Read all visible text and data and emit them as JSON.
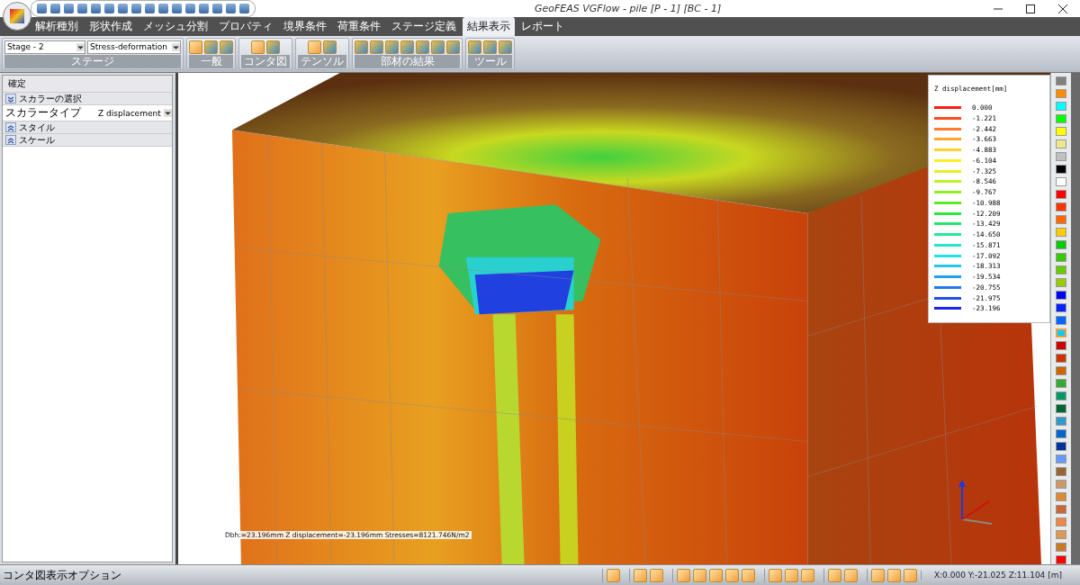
{
  "window": {
    "title": "GeoFEAS VGFlow - pile [P - 1] [BC - 1]"
  },
  "tabs": [
    {
      "label": "解析種別",
      "selected": false
    },
    {
      "label": "形状作成",
      "selected": false
    },
    {
      "label": "メッシュ分割",
      "selected": false
    },
    {
      "label": "プロパティ",
      "selected": false
    },
    {
      "label": "境界条件",
      "selected": false
    },
    {
      "label": "荷重条件",
      "selected": false
    },
    {
      "label": "ステージ定義",
      "selected": false
    },
    {
      "label": "結果表示",
      "selected": true
    },
    {
      "label": "レポート",
      "selected": false
    }
  ],
  "ribbon": {
    "stage_value": "Stage - 2",
    "analysis_value": "Stress-deformation",
    "groups": [
      {
        "label": "ステージ",
        "kind": "selects"
      },
      {
        "label": "一般",
        "kind": "icons"
      },
      {
        "label": "コンタ図",
        "kind": "icons"
      },
      {
        "label": "テンソル",
        "kind": "icons"
      },
      {
        "label": "部材の結果",
        "kind": "icons"
      },
      {
        "label": "ツール",
        "kind": "icons"
      }
    ]
  },
  "panel": {
    "header": "確定",
    "rows": [
      {
        "kind": "section",
        "label": "スカラーの選択",
        "expanded": true
      },
      {
        "kind": "property",
        "label": "スカラータイプ",
        "value": "Z displacement"
      },
      {
        "kind": "section",
        "label": "スタイル",
        "expanded": false
      },
      {
        "kind": "section",
        "label": "スケール",
        "expanded": false
      }
    ]
  },
  "legend": {
    "title": "Z displacement[mm]",
    "entries": [
      {
        "value": "0.000",
        "color": "#ff1a1a"
      },
      {
        "value": "-1.221",
        "color": "#ff4a1a"
      },
      {
        "value": "-2.442",
        "color": "#ff7a2a"
      },
      {
        "value": "-3.663",
        "color": "#ffa52a"
      },
      {
        "value": "-4.883",
        "color": "#ffd02a"
      },
      {
        "value": "-6.104",
        "color": "#ffee22"
      },
      {
        "value": "-7.325",
        "color": "#e6f022"
      },
      {
        "value": "-8.546",
        "color": "#bff022"
      },
      {
        "value": "-9.767",
        "color": "#8cf022"
      },
      {
        "value": "-10.988",
        "color": "#5aee22"
      },
      {
        "value": "-12.209",
        "color": "#2ee63a"
      },
      {
        "value": "-13.429",
        "color": "#22e66a"
      },
      {
        "value": "-14.650",
        "color": "#22e69a"
      },
      {
        "value": "-15.871",
        "color": "#22e6c6"
      },
      {
        "value": "-17.092",
        "color": "#22e0e6"
      },
      {
        "value": "-18.313",
        "color": "#22c6ee"
      },
      {
        "value": "-19.534",
        "color": "#22a0ee"
      },
      {
        "value": "-20.755",
        "color": "#2278ee"
      },
      {
        "value": "-21.975",
        "color": "#2250ee"
      },
      {
        "value": "-23.196",
        "color": "#1a22ee"
      }
    ]
  },
  "probe": "Dbh:=23.196mm  Z displacement=-23.196mm  Stresses=8121.746N/m2",
  "palette": [
    {
      "color": "#808080",
      "selected": false
    },
    {
      "color": "#ff8c00",
      "selected": false
    },
    {
      "color": "#00ffff",
      "selected": false
    },
    {
      "color": "#00ff00",
      "selected": false
    },
    {
      "color": "#ffff00",
      "selected": false
    },
    {
      "color": "#f0e68c",
      "selected": false
    },
    {
      "color": "#c0c0c0",
      "selected": false
    },
    {
      "color": "#000000",
      "selected": false
    },
    {
      "color": "#ffffff",
      "selected": false
    },
    {
      "color": "#ff0000",
      "selected": false
    },
    {
      "color": "#ff3300",
      "selected": false
    },
    {
      "color": "#ff6600",
      "selected": false
    },
    {
      "color": "#ffcc00",
      "selected": false
    },
    {
      "color": "#00cc00",
      "selected": false
    },
    {
      "color": "#33cc00",
      "selected": false
    },
    {
      "color": "#66cc00",
      "selected": false
    },
    {
      "color": "#99cc00",
      "selected": false
    },
    {
      "color": "#0000ff",
      "selected": false
    },
    {
      "color": "#0022ff",
      "selected": false
    },
    {
      "color": "#0066ff",
      "selected": false
    },
    {
      "color": "#00ccff",
      "selected": true
    },
    {
      "color": "#cc0000",
      "selected": false
    },
    {
      "color": "#cc3300",
      "selected": false
    },
    {
      "color": "#cc6600",
      "selected": false
    },
    {
      "color": "#33aa33",
      "selected": false
    },
    {
      "color": "#009966",
      "selected": false
    },
    {
      "color": "#006633",
      "selected": false
    },
    {
      "color": "#3399cc",
      "selected": false
    },
    {
      "color": "#0066cc",
      "selected": false
    },
    {
      "color": "#003399",
      "selected": false
    },
    {
      "color": "#6699ff",
      "selected": false
    },
    {
      "color": "#996633",
      "selected": false
    },
    {
      "color": "#cc9966",
      "selected": false
    },
    {
      "color": "#dd8833",
      "selected": false
    },
    {
      "color": "#cc6633",
      "selected": false
    },
    {
      "color": "#ee8844",
      "selected": false
    },
    {
      "color": "#dd9955",
      "selected": false
    },
    {
      "color": "#cc7722",
      "selected": false
    },
    {
      "color": "#ff0000",
      "selected": false
    }
  ],
  "status": {
    "label": "コンタ図表示オプション",
    "coords": "X:0.000 Y:-21.025 Z:11.104 [m]"
  }
}
